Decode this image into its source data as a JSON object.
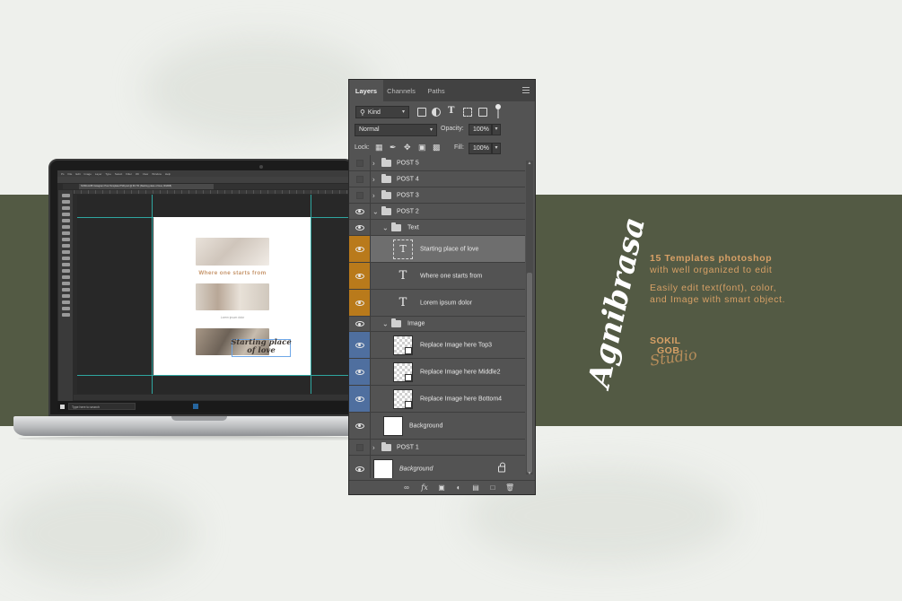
{
  "colors": {
    "background": "#eef0ec",
    "band": "#535a44",
    "accent": "#d7a066",
    "panel": "#535353",
    "text_layer_highlight": "#b97a1b",
    "image_layer_highlight": "#4f6f9f"
  },
  "laptop": {
    "menu_items": [
      "Ps",
      "File",
      "Edit",
      "Image",
      "Layer",
      "Type",
      "Select",
      "Filter",
      "3D",
      "View",
      "Window",
      "Help"
    ],
    "doc_tab_title": "SOKILGOB Instagram Post Template PSD.psd @ 66.7% (Starting place of love, RGB/8)",
    "doc_heading": "Where one starts from",
    "doc_lorem": "Lorem ipsum dolor",
    "doc_script": "Starting place of love",
    "taskbar_search": "Type here to search"
  },
  "layers_panel": {
    "tabs": [
      "Layers",
      "Channels",
      "Paths"
    ],
    "kind_filter": "Kind",
    "blend_mode": "Normal",
    "opacity_label": "Opacity:",
    "opacity_value": "100%",
    "lock_label": "Lock:",
    "fill_label": "Fill:",
    "fill_value": "100%",
    "layers": [
      {
        "name": "POST 5",
        "type": "group",
        "visible": false
      },
      {
        "name": "POST 4",
        "type": "group",
        "visible": false
      },
      {
        "name": "POST 3",
        "type": "group",
        "visible": false
      },
      {
        "name": "POST 2",
        "type": "group",
        "visible": true,
        "expanded": true
      },
      {
        "name": "Text",
        "type": "group",
        "visible": true,
        "expanded": true
      },
      {
        "name": "Starting place of love",
        "type": "text",
        "visible": true,
        "selected": true
      },
      {
        "name": "Where one starts from",
        "type": "text",
        "visible": true
      },
      {
        "name": "Lorem ipsum dolor",
        "type": "text",
        "visible": true
      },
      {
        "name": "Image",
        "type": "group",
        "visible": true,
        "expanded": true
      },
      {
        "name": "Replace Image here Top3",
        "type": "smart-object",
        "visible": true
      },
      {
        "name": "Replace Image here Middle2",
        "type": "smart-object",
        "visible": true
      },
      {
        "name": "Replace Image here Bottom4",
        "type": "smart-object",
        "visible": true
      },
      {
        "name": "Background",
        "type": "pixel",
        "visible": true
      },
      {
        "name": "POST 1",
        "type": "group",
        "visible": false
      },
      {
        "name": "Background",
        "type": "locked-background",
        "visible": true
      }
    ]
  },
  "branding": {
    "brand_word": "Agnibrasa",
    "promo_line1": "15 Templates photoshop",
    "promo_line2": "with well organized to edit",
    "promo_line3": "Easily edit text(font), color,",
    "promo_line4": "and Image with smart object.",
    "logo_line1": "SOKIL",
    "logo_line2": "GOB",
    "logo_script": "Studio"
  }
}
